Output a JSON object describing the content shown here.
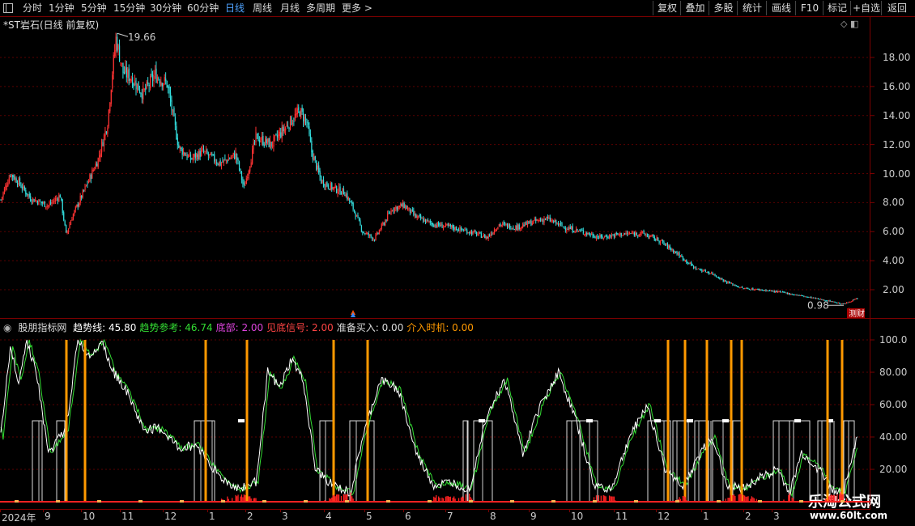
{
  "toolbar": {
    "periods": [
      "分时",
      "1分钟",
      "5分钟",
      "15分钟",
      "30分钟",
      "60分钟",
      "日线",
      "周线",
      "月线",
      "多周期",
      "更多 >"
    ],
    "active_period": "日线",
    "buttons": [
      "复权",
      "叠加",
      "多股",
      "统计",
      "画线",
      "F10",
      "标记",
      "+自选",
      "返回"
    ]
  },
  "stock": {
    "title": "*ST岩石(日线 前复权)",
    "high_label": "19.66",
    "low_label": "0.98",
    "finance_badge": "测财"
  },
  "price_axis": [
    "18.00",
    "16.00",
    "14.00",
    "12.00",
    "10.00",
    "8.00",
    "6.00",
    "4.00",
    "2.00"
  ],
  "indicator": {
    "name": "股朋指标网",
    "items": [
      {
        "label": "趋势线:",
        "value": "45.80",
        "color": "#ffffff"
      },
      {
        "label": "趋势参考:",
        "value": "46.74",
        "color": "#33dd33"
      },
      {
        "label": "底部:",
        "value": "2.00",
        "color": "#dd44dd"
      },
      {
        "label": "见底信号:",
        "value": "2.00",
        "color": "#ff4444"
      },
      {
        "label": "准备买入:",
        "value": "0.00",
        "color": "#dddddd"
      },
      {
        "label": "介入时机:",
        "value": "0.00",
        "color": "#ff9900"
      }
    ],
    "axis": [
      "100.0",
      "80.00",
      "60.00",
      "40.00",
      "20.00"
    ]
  },
  "date_axis": [
    "2024年",
    "9",
    "10",
    "11",
    "12",
    "1",
    "2",
    "3",
    "4",
    "5",
    "6",
    "7",
    "8",
    "9",
    "10",
    "11",
    "12",
    "1",
    "2",
    "3"
  ],
  "watermark": {
    "title": "乐淘公式网",
    "url": "www.60lt.com"
  },
  "colors": {
    "up": "#ff3333",
    "down": "#33dddd",
    "axis": "#7a0000",
    "trend": "#ffffff",
    "ref": "#33dd33",
    "signal": "#ff9900",
    "bottom": "#ff2222"
  }
}
